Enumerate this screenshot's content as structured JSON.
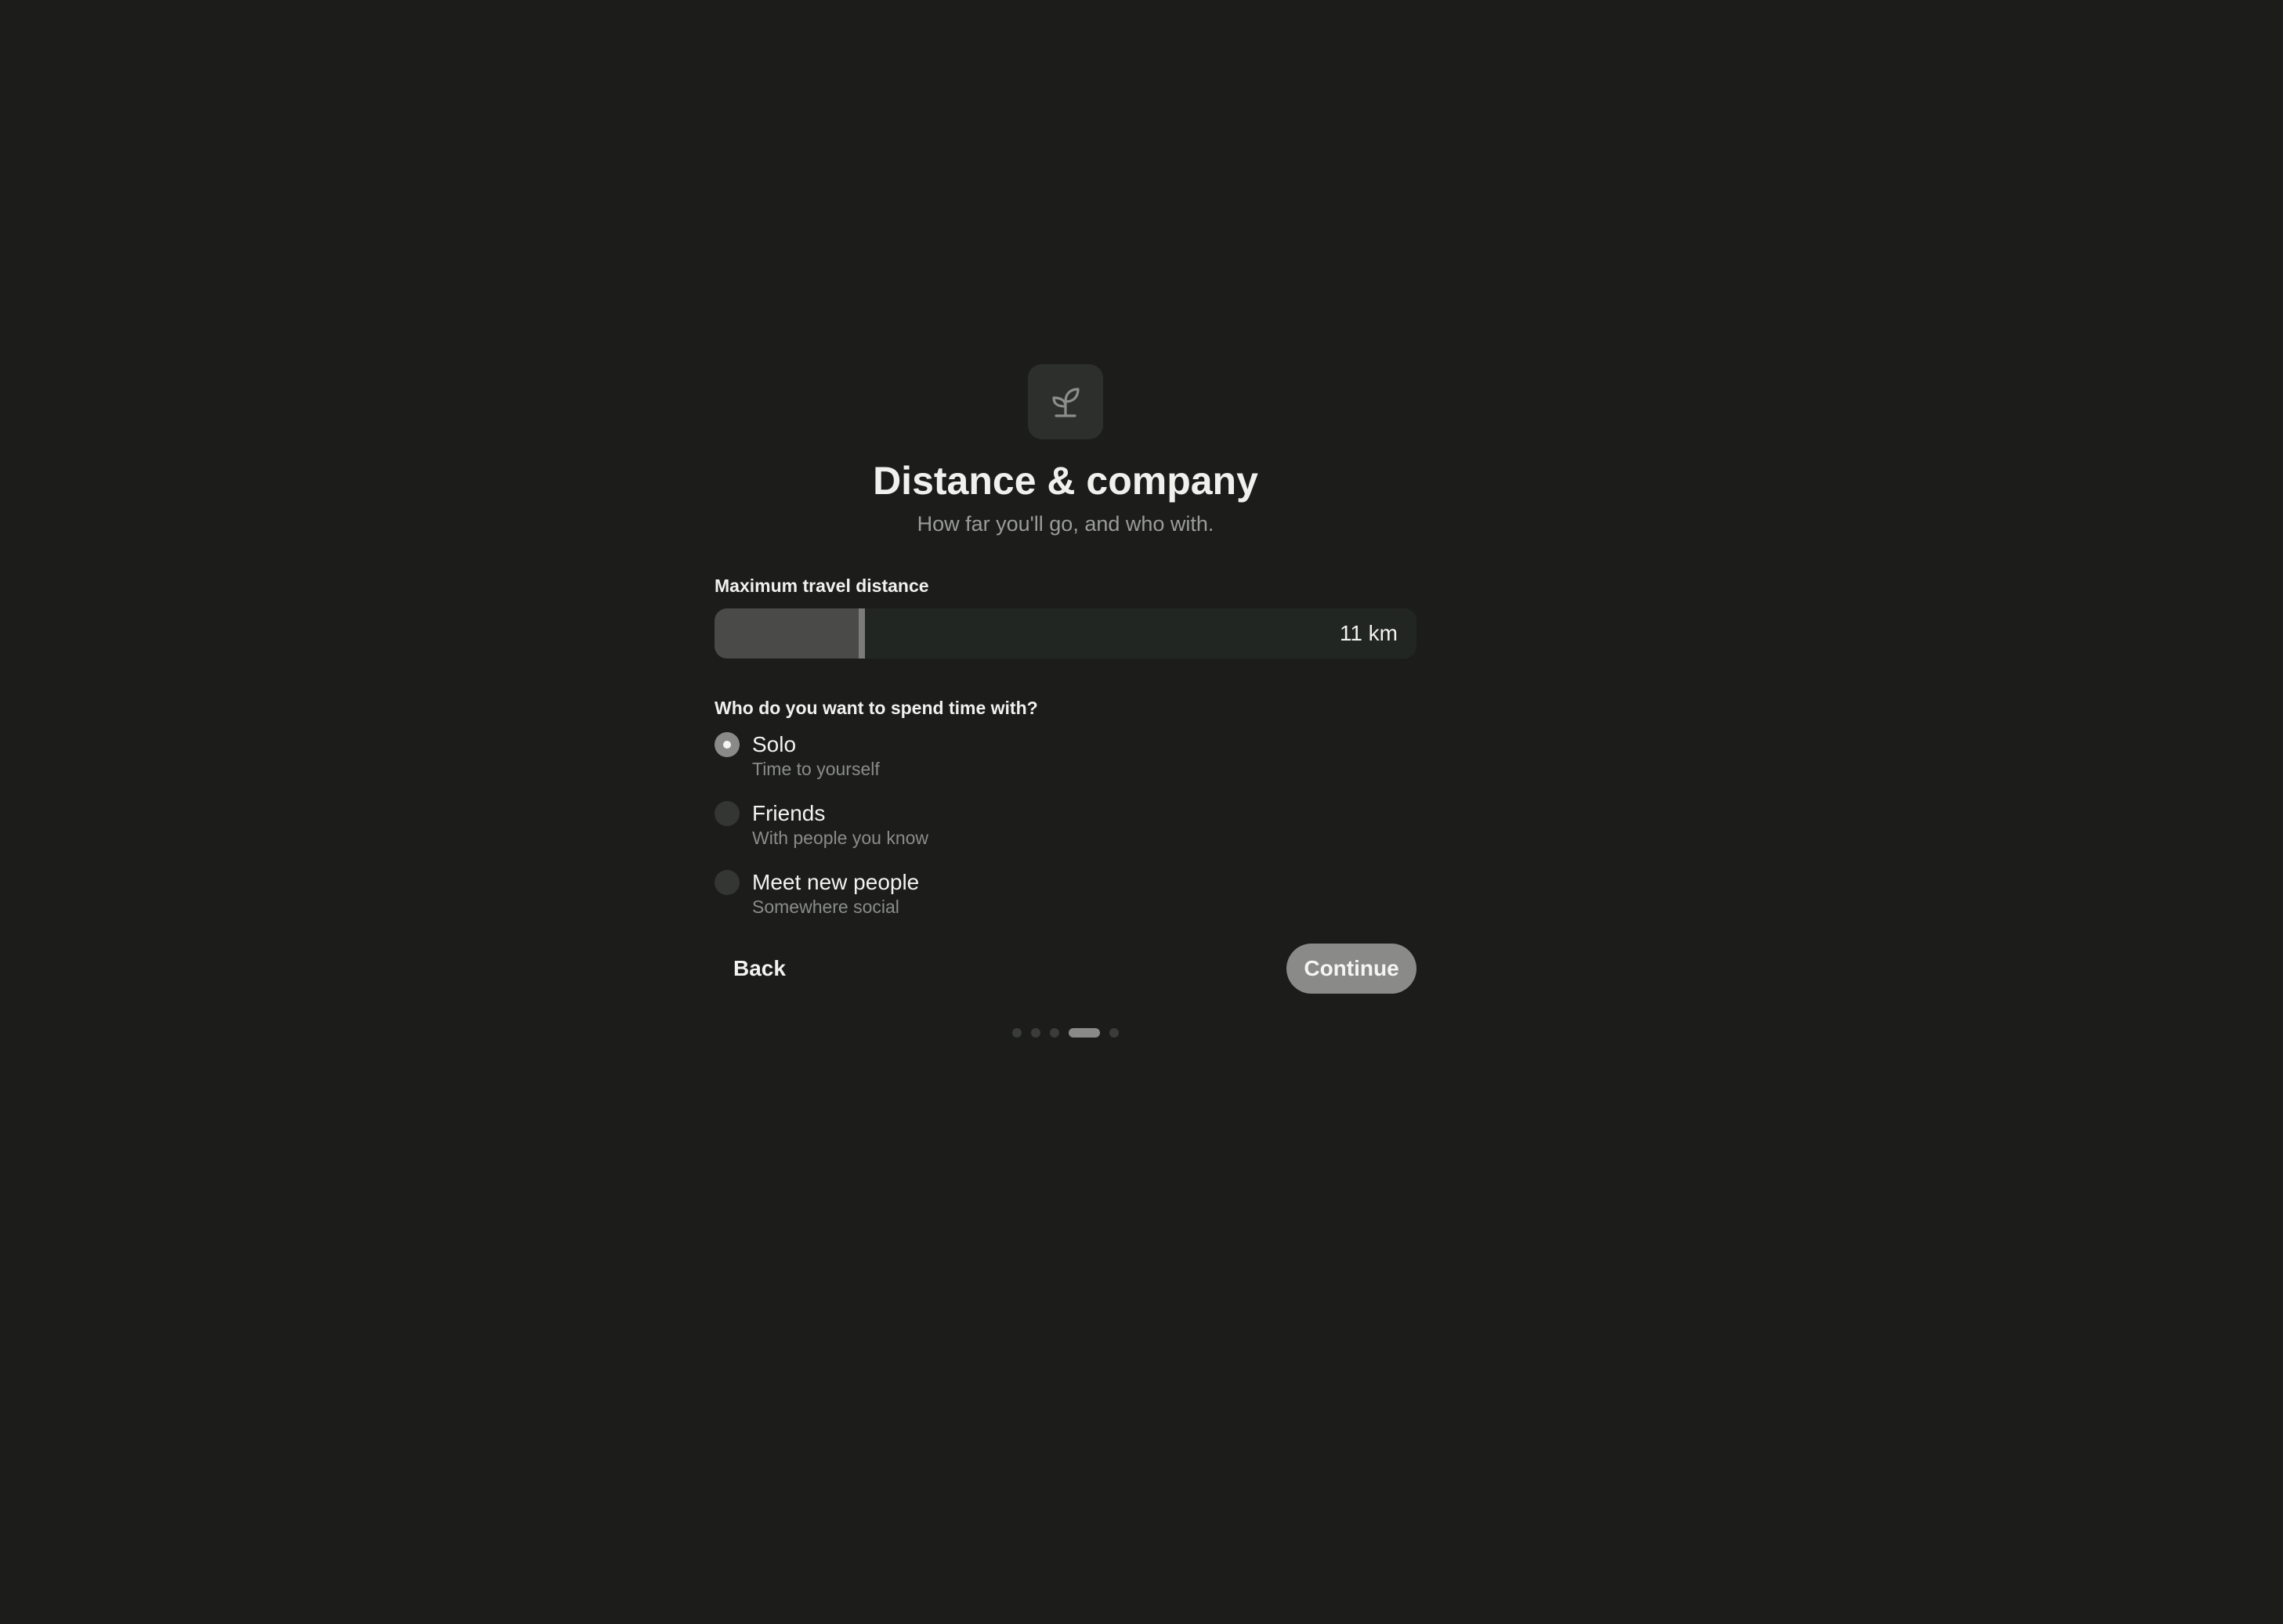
{
  "header": {
    "icon": "seedling-icon",
    "title": "Distance & company",
    "subtitle": "How far you'll go, and who with."
  },
  "distance": {
    "label": "Maximum travel distance",
    "value_text": "11 km",
    "fill_fraction": 0.21
  },
  "company": {
    "label": "Who do you want to spend time with?",
    "options": [
      {
        "title": "Solo",
        "subtitle": "Time to yourself",
        "selected": true
      },
      {
        "title": "Friends",
        "subtitle": "With people you know",
        "selected": false
      },
      {
        "title": "Meet new people",
        "subtitle": "Somewhere social",
        "selected": false
      }
    ]
  },
  "actions": {
    "back_label": "Back",
    "continue_label": "Continue"
  },
  "pager": {
    "total": 5,
    "current": 4
  },
  "colors": {
    "background": "#1c1d1b",
    "accent": "#8a8b88"
  }
}
